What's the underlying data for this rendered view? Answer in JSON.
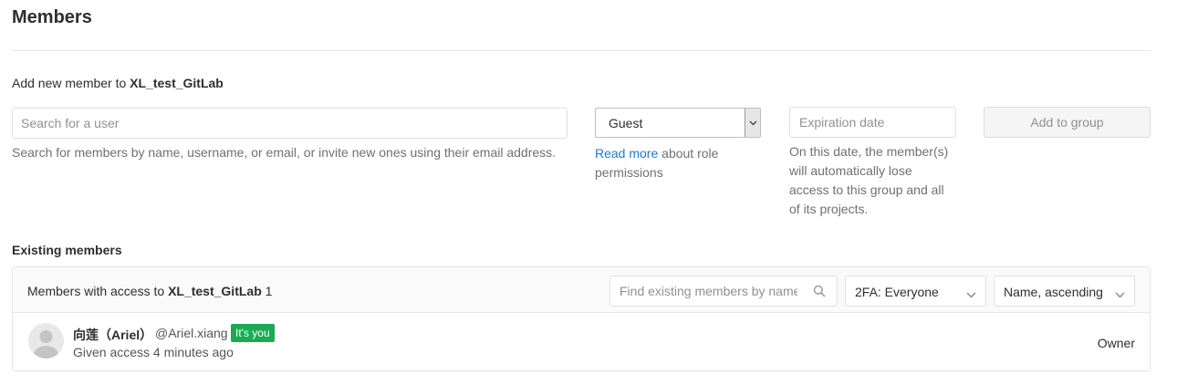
{
  "page": {
    "title": "Members"
  },
  "add_member": {
    "prefix": "Add new member to ",
    "group_name": "XL_test_GitLab",
    "search_placeholder": "Search for a user",
    "search_help": "Search for members by name, username, or email, or invite new ones using their email address.",
    "role_value": "Guest",
    "role_help_link": "Read more",
    "role_help_text": " about role permissions",
    "expiration_placeholder": "Expiration date",
    "expiration_help": "On this date, the member(s) will automatically lose access to this group and all of its projects.",
    "add_button": "Add to group"
  },
  "existing": {
    "title": "Existing members",
    "header_prefix": "Members with access to ",
    "group_name": "XL_test_GitLab",
    "count": "1",
    "find_placeholder": "Find existing members by name",
    "filter_2fa": "2FA: Everyone",
    "sort": "Name, ascending",
    "members": [
      {
        "name": "向莲（Ariel）",
        "username": "@Ariel.xiang",
        "badge": "It's you",
        "access": "Given access 4 minutes ago",
        "role": "Owner"
      }
    ]
  },
  "colors": {
    "link": "#1f78d1",
    "badge": "#1aaa55"
  }
}
